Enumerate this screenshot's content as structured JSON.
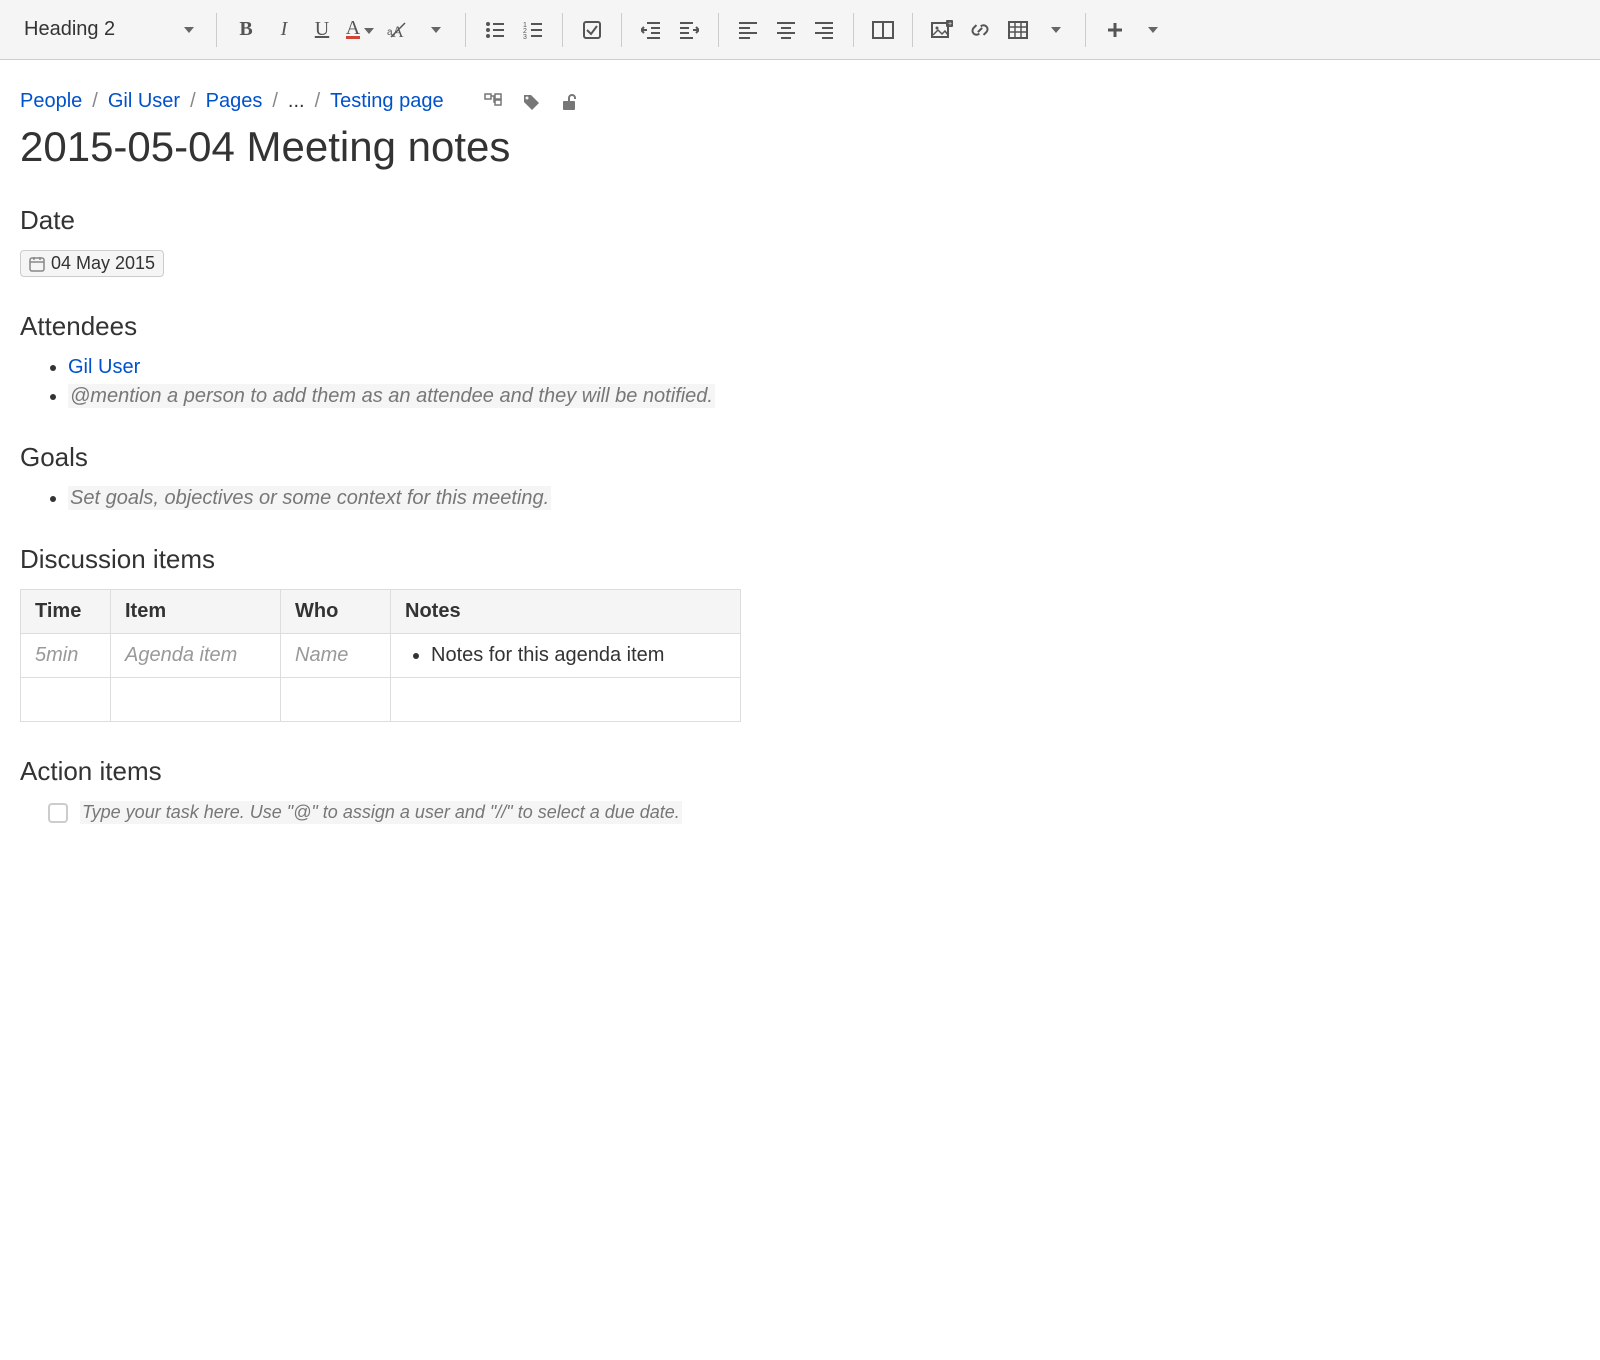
{
  "toolbar": {
    "style_select": "Heading 2"
  },
  "breadcrumb": {
    "items": [
      "People",
      "Gil User",
      "Pages",
      "...",
      "Testing page"
    ]
  },
  "page": {
    "title": "2015-05-04 Meeting notes"
  },
  "date_section": {
    "heading": "Date",
    "value": "04 May 2015"
  },
  "attendees_section": {
    "heading": "Attendees",
    "user": "Gil User",
    "hint": "@mention a person to add them as an attendee and they will be notified."
  },
  "goals_section": {
    "heading": "Goals",
    "hint": "Set goals, objectives or some context for this meeting."
  },
  "discussion_section": {
    "heading": "Discussion items",
    "headers": {
      "time": "Time",
      "item": "Item",
      "who": "Who",
      "notes": "Notes"
    },
    "row1": {
      "time": "5min",
      "item": "Agenda item",
      "who": "Name",
      "notes": "Notes for this agenda item"
    }
  },
  "action_section": {
    "heading": "Action items",
    "hint": "Type your task here. Use \"@\" to assign a user and \"//\" to select a due date."
  }
}
